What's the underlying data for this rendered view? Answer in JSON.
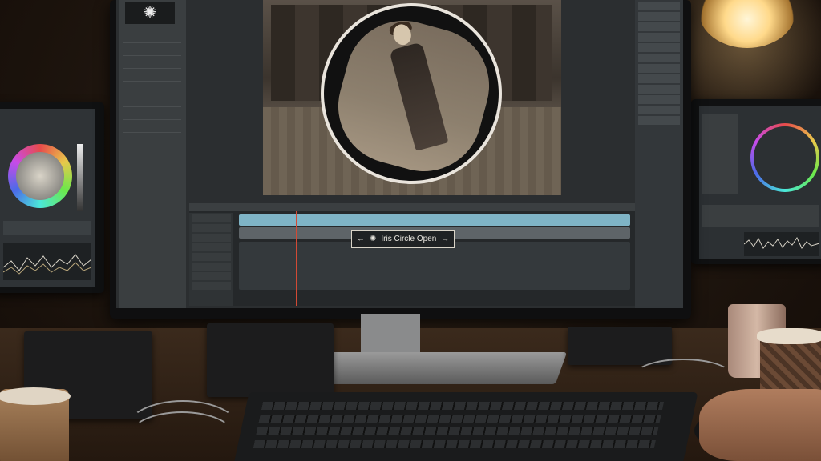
{
  "app": {
    "logo_glyph": "✺"
  },
  "timeline": {
    "clip_label": "Iris Circle Open",
    "arrow_left": "←",
    "arrow_right": "→",
    "clip_glyph": "✺"
  },
  "icons": [
    "aperture-icon",
    "arrow-left-icon",
    "arrow-right-icon",
    "color-wheel",
    "lamp"
  ],
  "colors": {
    "timeline_track": "#7fb4c6",
    "playhead": "#d24a35",
    "panel_bg": "#3a3e40",
    "lamp_glow": "#ffd98a"
  }
}
